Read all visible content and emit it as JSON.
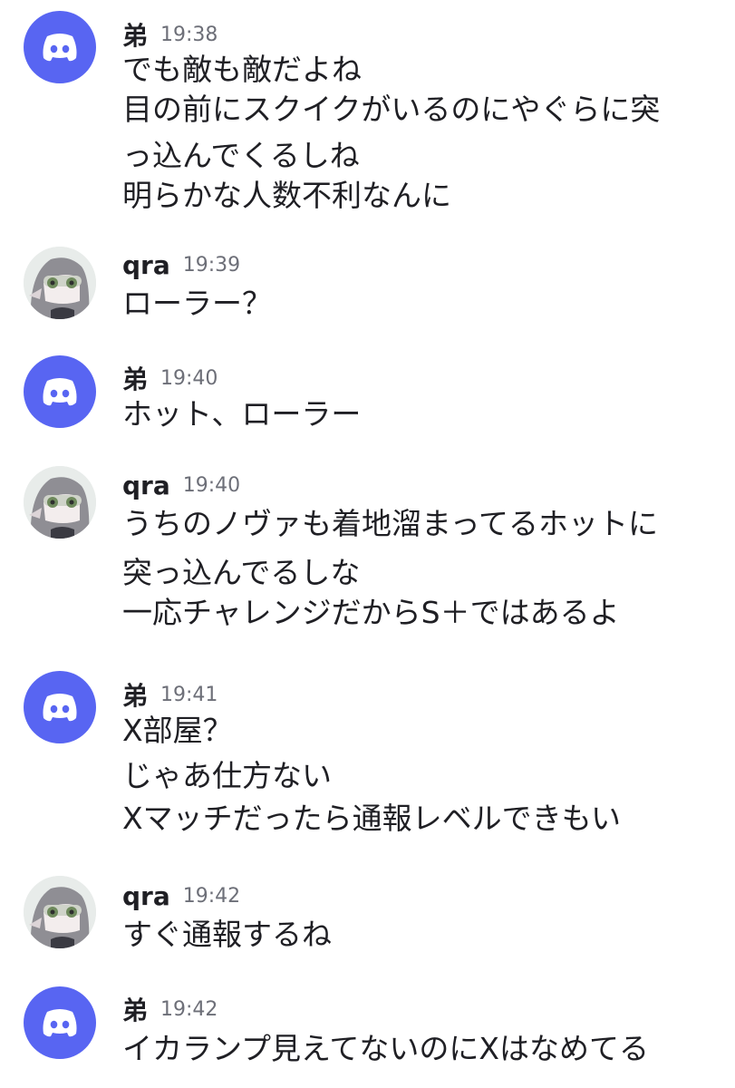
{
  "messages": [
    {
      "author": "弟",
      "time": "19:38",
      "avatar": "discord-logo-icon",
      "lines": [
        "でも敵も敵だよね",
        "目の前にスクイクがいるのにやぐらに突",
        "っ込んでくるしね",
        "明らかな人数不利なんに"
      ]
    },
    {
      "author": "qra",
      "time": "19:39",
      "avatar": "squid-character-avatar",
      "lines": [
        "ローラー？"
      ]
    },
    {
      "author": "弟",
      "time": "19:40",
      "avatar": "discord-logo-icon",
      "lines": [
        "ホット、ローラー"
      ]
    },
    {
      "author": "qra",
      "time": "19:40",
      "avatar": "squid-character-avatar",
      "lines": [
        "うちのノヴァも着地溜まってるホットに",
        "突っ込んでるしな",
        "一応チャレンジだからS＋ではあるよ"
      ]
    },
    {
      "author": "弟",
      "time": "19:41",
      "avatar": "discord-logo-icon",
      "lines": [
        "X部屋？",
        "じゃあ仕方ない",
        "Xマッチだったら通報レベルできもい"
      ]
    },
    {
      "author": "qra",
      "time": "19:42",
      "avatar": "squid-character-avatar",
      "lines": [
        "すぐ通報するね"
      ]
    },
    {
      "author": "弟",
      "time": "19:42",
      "avatar": "discord-logo-icon",
      "lines": [
        "イカランプ見えてないのにXはなめてる"
      ]
    }
  ],
  "colors": {
    "discord_blurple": "#5865f2",
    "text": "#1f1f24",
    "timestamp": "#6d6f78"
  }
}
